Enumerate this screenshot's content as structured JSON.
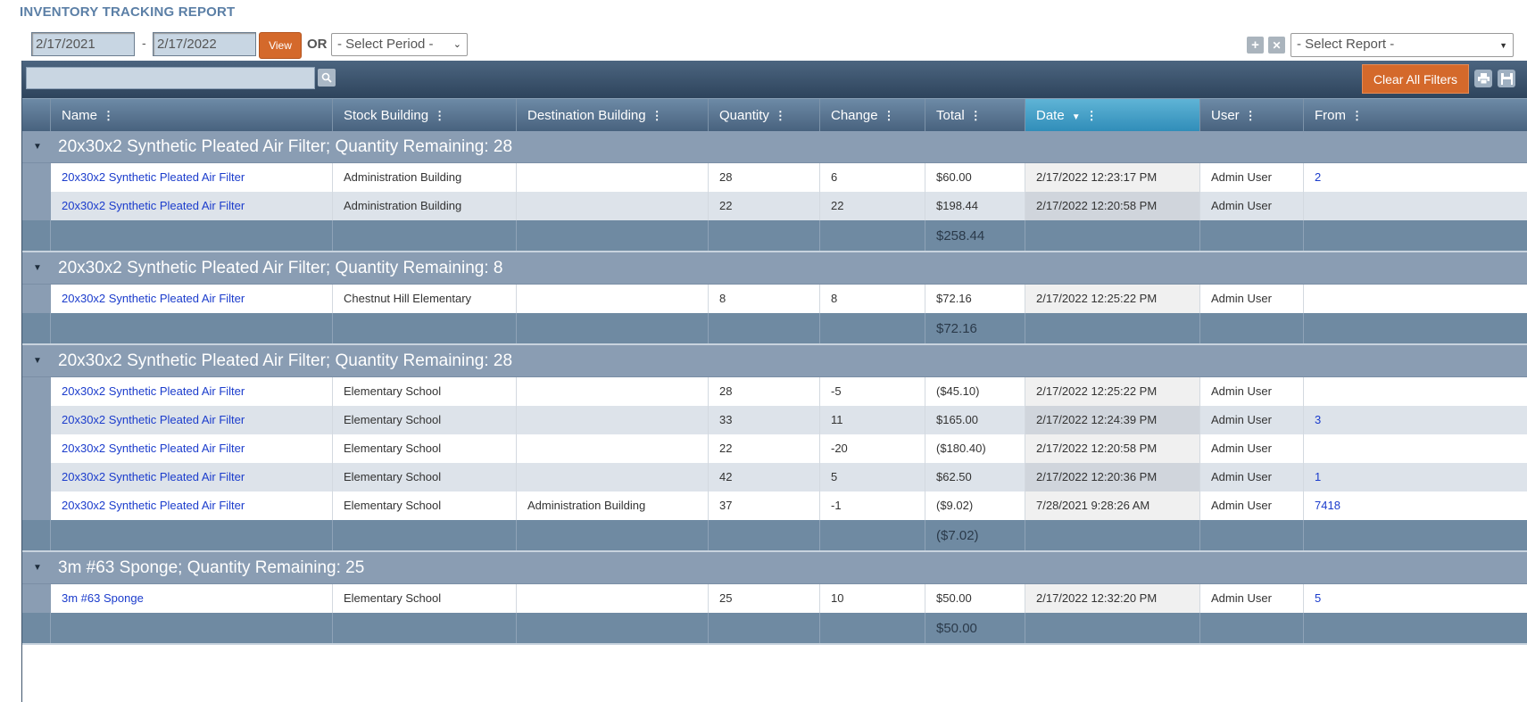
{
  "title": "INVENTORY TRACKING REPORT",
  "toolbar": {
    "date_from": "2/17/2021",
    "dash": "-",
    "date_to": "2/17/2022",
    "view_label": "View",
    "or_label": "OR",
    "period_select": "- Select Period -",
    "report_select": "- Select Report -",
    "add_icon": "+",
    "remove_icon": "✕"
  },
  "filter_bar": {
    "search_placeholder": "",
    "clear_label": "Clear All Filters"
  },
  "columns": [
    "Name",
    "Stock Building",
    "Destination Building",
    "Quantity",
    "Change",
    "Total",
    "Date",
    "User",
    "From"
  ],
  "sorted_column": "Date",
  "groups": [
    {
      "header": "20x30x2 Synthetic Pleated Air Filter; Quantity Remaining: 28",
      "rows": [
        [
          "20x30x2 Synthetic Pleated Air Filter",
          "Administration Building",
          "",
          "28",
          "6",
          "$60.00",
          "2/17/2022 12:23:17 PM",
          "Admin User",
          "2"
        ],
        [
          "20x30x2 Synthetic Pleated Air Filter",
          "Administration Building",
          "",
          "22",
          "22",
          "$198.44",
          "2/17/2022 12:20:58 PM",
          "Admin User",
          ""
        ]
      ],
      "total": "$258.44"
    },
    {
      "header": "20x30x2 Synthetic Pleated Air Filter; Quantity Remaining: 8",
      "rows": [
        [
          "20x30x2 Synthetic Pleated Air Filter",
          "Chestnut Hill Elementary",
          "",
          "8",
          "8",
          "$72.16",
          "2/17/2022 12:25:22 PM",
          "Admin User",
          ""
        ]
      ],
      "total": "$72.16"
    },
    {
      "header": "20x30x2 Synthetic Pleated Air Filter; Quantity Remaining: 28",
      "rows": [
        [
          "20x30x2 Synthetic Pleated Air Filter",
          "Elementary School",
          "",
          "28",
          "-5",
          "($45.10)",
          "2/17/2022 12:25:22 PM",
          "Admin User",
          ""
        ],
        [
          "20x30x2 Synthetic Pleated Air Filter",
          "Elementary School",
          "",
          "33",
          "11",
          "$165.00",
          "2/17/2022 12:24:39 PM",
          "Admin User",
          "3"
        ],
        [
          "20x30x2 Synthetic Pleated Air Filter",
          "Elementary School",
          "",
          "22",
          "-20",
          "($180.40)",
          "2/17/2022 12:20:58 PM",
          "Admin User",
          ""
        ],
        [
          "20x30x2 Synthetic Pleated Air Filter",
          "Elementary School",
          "",
          "42",
          "5",
          "$62.50",
          "2/17/2022 12:20:36 PM",
          "Admin User",
          "1"
        ],
        [
          "20x30x2 Synthetic Pleated Air Filter",
          "Elementary School",
          "Administration Building",
          "37",
          "-1",
          "($9.02)",
          "7/28/2021 9:28:26 AM",
          "Admin User",
          "7418"
        ]
      ],
      "total": "($7.02)"
    },
    {
      "header": "3m #63 Sponge; Quantity Remaining: 25",
      "rows": [
        [
          "3m #63 Sponge",
          "Elementary School",
          "",
          "25",
          "10",
          "$50.00",
          "2/17/2022 12:32:20 PM",
          "Admin User",
          "5"
        ]
      ],
      "total": "$50.00"
    }
  ],
  "colors": {
    "accent_orange": "#d4692b",
    "header_blue": "#48627e",
    "active_header": "#2f8cb8",
    "group_row": "#8a9db3",
    "summary_row": "#6f8aa2",
    "link": "#1b3ccc"
  },
  "icons": {
    "search": "search-icon",
    "print": "print-icon",
    "save": "save-icon",
    "add": "plus-icon",
    "remove": "x-icon",
    "expand": "triangle-down-icon",
    "sort": "sort-desc-icon",
    "menu": "kebab-icon"
  }
}
